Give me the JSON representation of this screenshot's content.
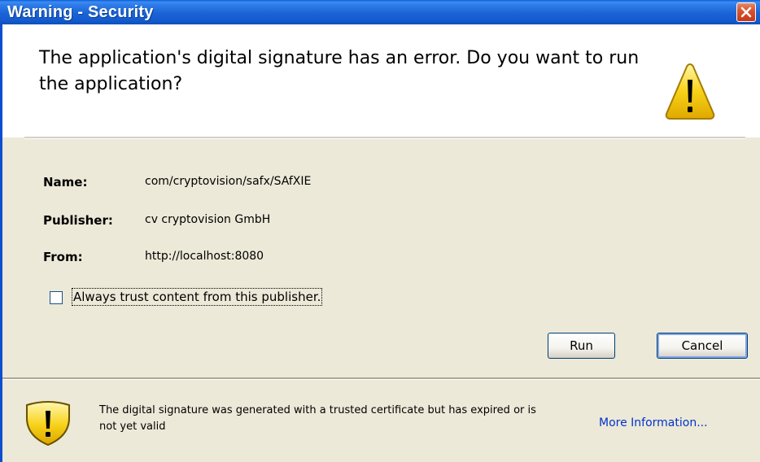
{
  "window": {
    "title": "Warning - Security"
  },
  "header": {
    "message": "The application's digital signature has an error.  Do you want to run the application?",
    "icon": "warning-triangle-icon"
  },
  "details": {
    "name_label": "Name:",
    "name_value": "com/cryptovision/safx/SAfXIE",
    "publisher_label": "Publisher:",
    "publisher_value": "cv cryptovision GmbH",
    "from_label": "From:",
    "from_value": "http://localhost:8080"
  },
  "trust_checkbox": {
    "label": "Always trust content from this publisher.",
    "checked": false
  },
  "buttons": {
    "run_label": "Run",
    "cancel_label": "Cancel"
  },
  "footer": {
    "message": "The digital signature was generated with a trusted certificate but has expired or is not yet valid",
    "link_label": "More Information...",
    "icon": "warning-shield-icon"
  },
  "colors": {
    "titlebar": "#145ccf",
    "dialog_bg": "#ece9d8",
    "close_button": "#d9542c",
    "link": "#0033cc",
    "warning_yellow": "#f7d117"
  }
}
